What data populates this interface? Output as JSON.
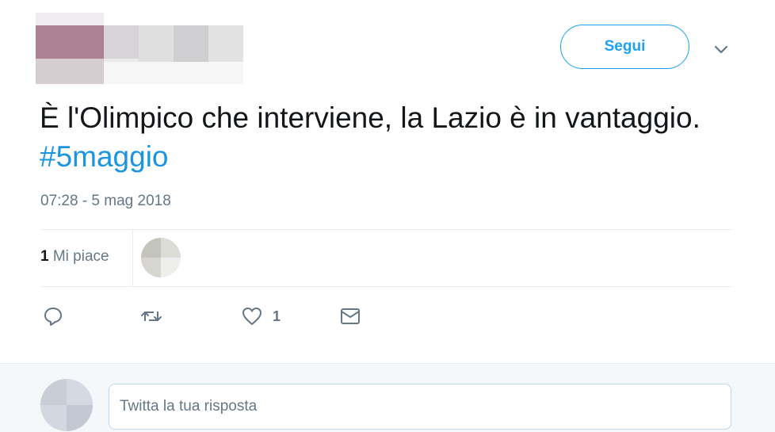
{
  "header": {
    "follow_label": "Segui",
    "caret_icon": "chevron-down-icon"
  },
  "tweet": {
    "text": "È l'Olimpico che interviene, la Lazio è in vantaggio.",
    "hashtag": "#5maggio",
    "timestamp": "07:28 - 5 mag 2018"
  },
  "stats": {
    "likes_count": "1",
    "likes_label": "Mi piace"
  },
  "actions": {
    "reply_icon": "reply-icon",
    "retweet_icon": "retweet-icon",
    "like_icon": "heart-icon",
    "like_count": "1",
    "dm_icon": "envelope-icon"
  },
  "reply": {
    "placeholder": "Twitta la tua risposta"
  },
  "colors": {
    "accent": "#1da1f2",
    "hashtag": "#1b95e0",
    "muted": "#657786",
    "divider": "#e6ecf0"
  }
}
